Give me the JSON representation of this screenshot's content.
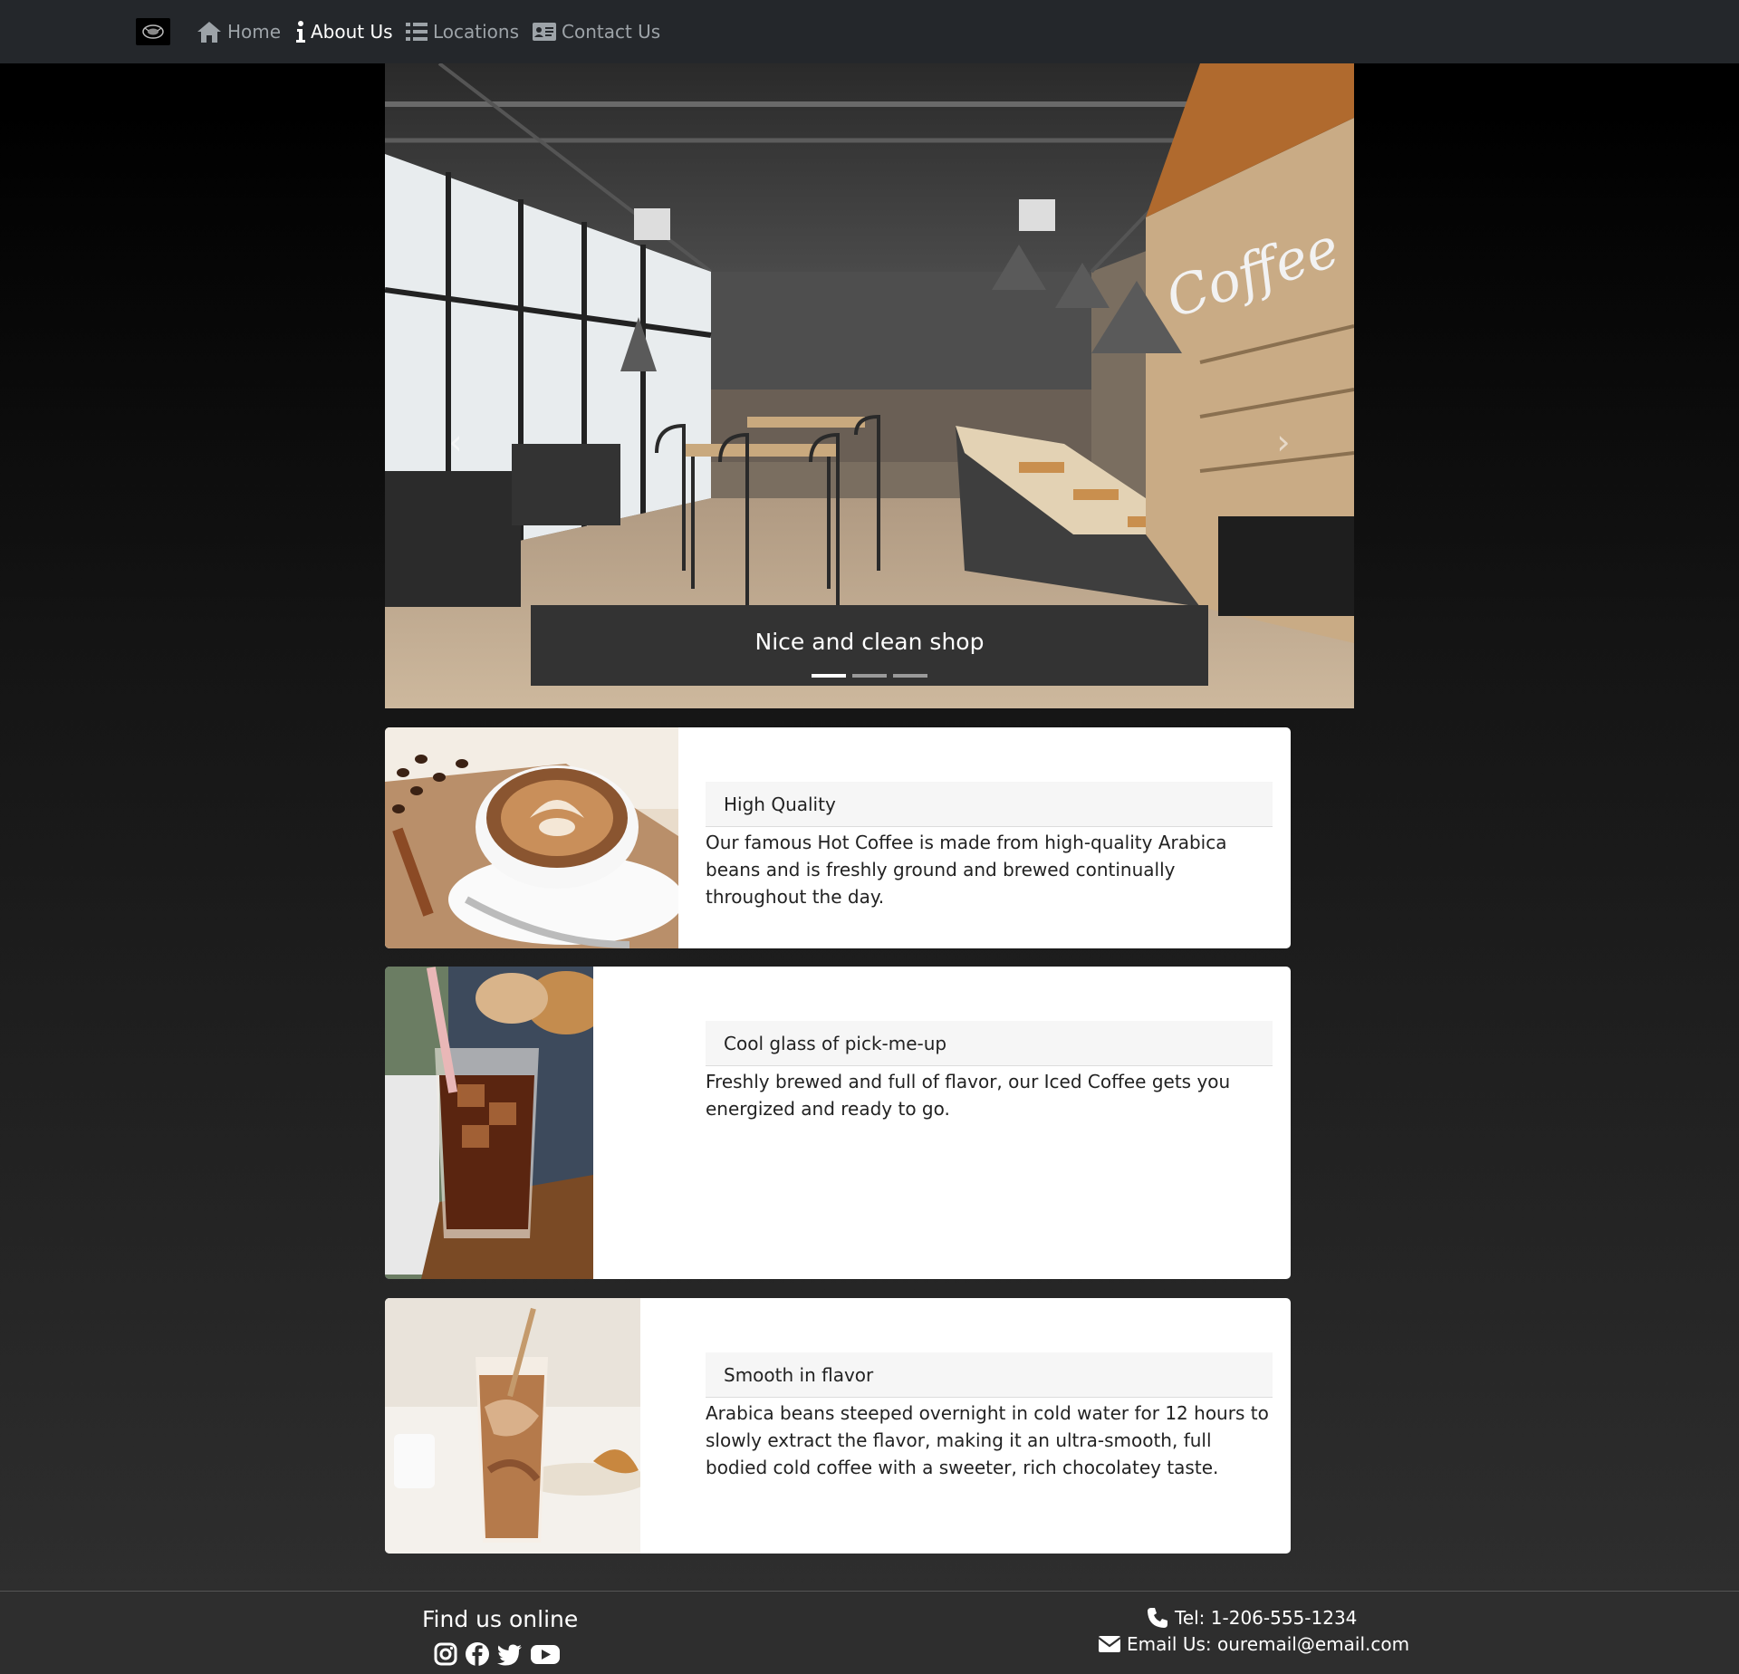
{
  "nav": {
    "logo_icon": "coffee-logo",
    "items": [
      {
        "label": "Home",
        "icon": "home-icon",
        "active": false
      },
      {
        "label": "About Us",
        "icon": "info-icon",
        "active": true
      },
      {
        "label": "Locations",
        "icon": "list-icon",
        "active": false
      },
      {
        "label": "Contact Us",
        "icon": "id-card-icon",
        "active": false
      }
    ]
  },
  "carousel": {
    "caption": "Nice and clean shop",
    "slide_count": 3,
    "active_index": 0
  },
  "cards": [
    {
      "title": "High Quality",
      "text": "Our famous Hot Coffee is made from high-quality Arabica beans and is freshly ground and brewed continually throughout the day.",
      "image": "latte-cup-photo"
    },
    {
      "title": "Cool glass of pick-me-up",
      "text": "Freshly brewed and full of flavor, our Iced Coffee gets you energized and ready to go.",
      "image": "iced-coffee-photo"
    },
    {
      "title": "Smooth in flavor",
      "text": "Arabica beans steeped overnight in cold water for 12 hours to slowly extract the flavor, making it an ultra-smooth, full bodied cold coffee with a sweeter, rich chocolatey taste.",
      "image": "cold-brew-photo"
    }
  ],
  "footer": {
    "find_title": "Find us online",
    "social_icons": [
      "instagram-icon",
      "facebook-icon",
      "twitter-icon",
      "youtube-icon"
    ],
    "tel": "Tel: 1-206-555-1234",
    "email": "Email Us: ouremail@email.com"
  },
  "colors": {
    "navbar": "#24272b",
    "nav_inactive": "#9da3a8",
    "nav_active": "#ffffff",
    "caption_bg": "#333333",
    "card_bg": "#ffffff",
    "card_header_bg": "#f6f6f6"
  }
}
